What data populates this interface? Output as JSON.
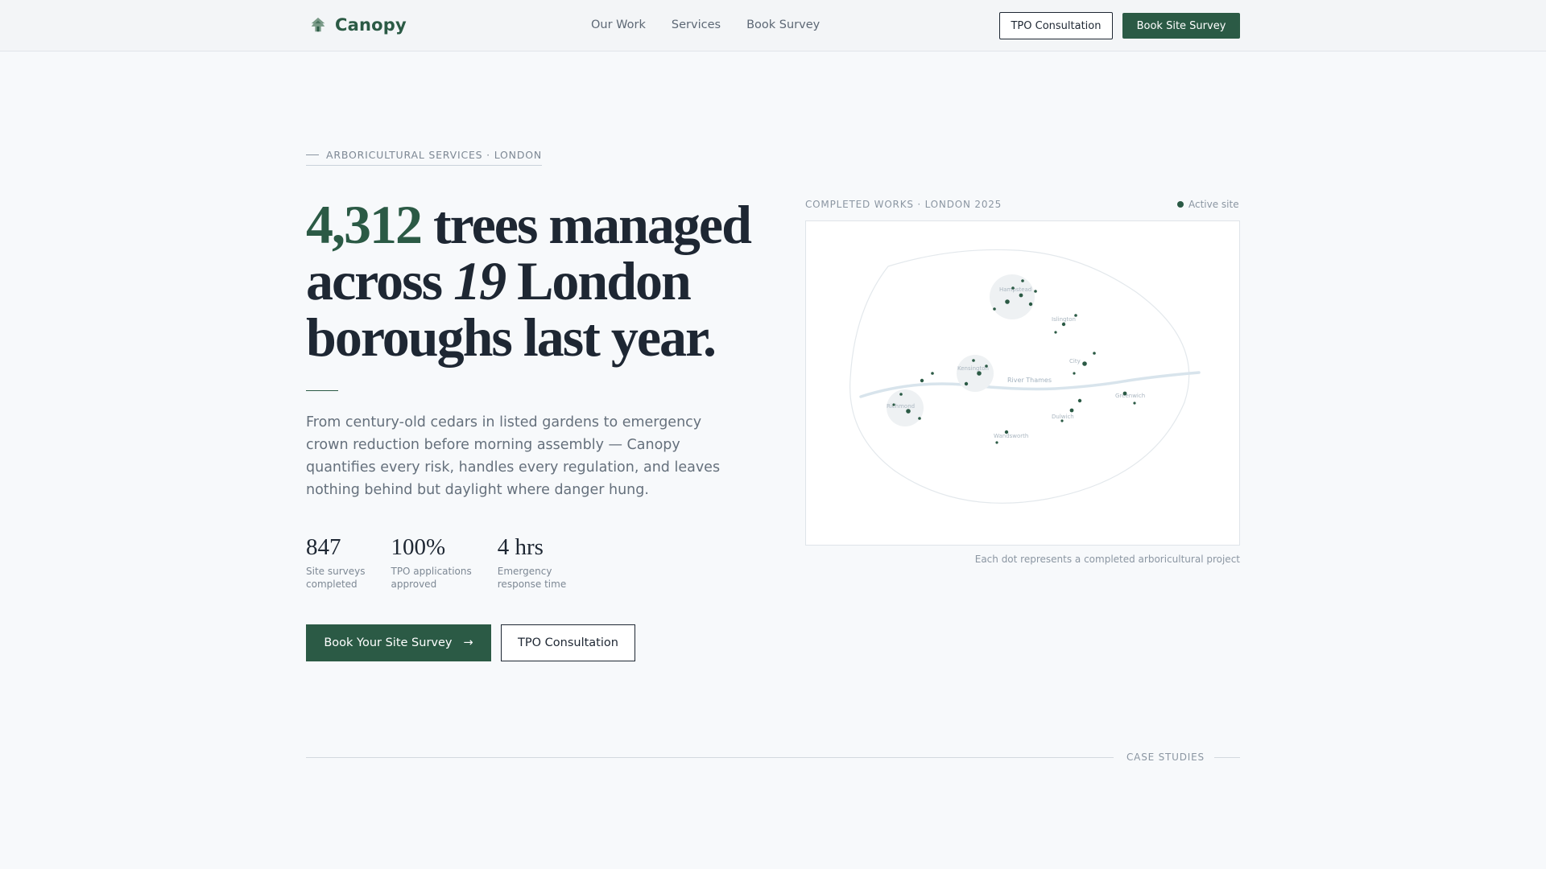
{
  "nav": {
    "brand": "Canopy",
    "links": [
      "Our Work",
      "Services",
      "Book Survey"
    ],
    "consult_label": "TPO Consultation",
    "survey_label": "Book Site Survey"
  },
  "hero": {
    "eyebrow": "ARBORICULTURAL SERVICES · LONDON",
    "headline_number": "4,312",
    "headline_part1": " trees managed across ",
    "headline_boroughs": "19",
    "headline_part2": " London boroughs last year.",
    "lede": "From century-old cedars in listed gardens to emergency crown reduction before morning assembly — Canopy quantifies every risk, handles every regulation, and leaves nothing behind but daylight where danger hung.",
    "stats": [
      {
        "value": "847",
        "label_line1": "Site surveys",
        "label_line2": "completed"
      },
      {
        "value": "100%",
        "label_line1": "TPO applications",
        "label_line2": "approved"
      },
      {
        "value": "4 hrs",
        "label_line1": "Emergency",
        "label_line2": "response time"
      }
    ],
    "primary_cta": "Book Your Site Survey",
    "primary_cta_arrow": "→",
    "secondary_cta": "TPO Consultation"
  },
  "map": {
    "caption_top": "COMPLETED WORKS · LONDON 2025",
    "legend_label": "Active site",
    "river_label": "River Thames",
    "areas": [
      "Hampstead",
      "Islington",
      "City",
      "Kensington",
      "Richmond",
      "Greenwich",
      "Dulwich",
      "Wandsworth"
    ],
    "caption_bottom": "Each dot represents a completed arboricultural project",
    "accent_color": "#2b5a45"
  },
  "case_studies": {
    "label": "CASE STUDIES"
  },
  "colors": {
    "brand": "#2b5a45",
    "text": "#1e2733",
    "muted": "#7d8894",
    "background": "#f7f9fb"
  }
}
